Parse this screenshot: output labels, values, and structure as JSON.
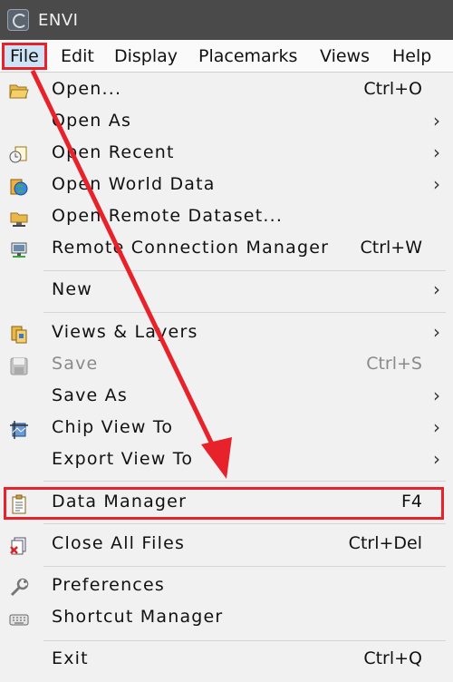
{
  "window": {
    "title": "ENVI"
  },
  "menubar": [
    {
      "label": "File",
      "active": true
    },
    {
      "label": "Edit"
    },
    {
      "label": "Display"
    },
    {
      "label": "Placemarks"
    },
    {
      "label": "Views"
    },
    {
      "label": "Help"
    }
  ],
  "file_menu": [
    {
      "label": "Open...",
      "shortcut": "Ctrl+O",
      "icon": "folder-open-icon"
    },
    {
      "label": "Open As",
      "submenu": true
    },
    {
      "label": "Open Recent",
      "submenu": true,
      "icon": "recent-files-icon"
    },
    {
      "label": "Open World Data",
      "submenu": true,
      "icon": "world-data-icon"
    },
    {
      "label": "Open Remote Dataset...",
      "icon": "remote-dataset-icon"
    },
    {
      "label": "Remote Connection Manager",
      "shortcut": "Ctrl+W",
      "icon": "remote-connection-icon"
    },
    {
      "label": "New",
      "submenu": true
    },
    {
      "label": "Views & Layers",
      "submenu": true,
      "icon": "views-layers-icon"
    },
    {
      "label": "Save",
      "shortcut": "Ctrl+S",
      "disabled": true,
      "icon": "save-icon"
    },
    {
      "label": "Save As",
      "submenu": true
    },
    {
      "label": "Chip View To",
      "submenu": true,
      "icon": "chip-view-icon"
    },
    {
      "label": "Export View To",
      "submenu": true
    },
    {
      "label": "Data Manager",
      "shortcut": "F4",
      "highlighted": true,
      "icon": "data-manager-icon"
    },
    {
      "label": "Close All Files",
      "shortcut": "Ctrl+Del",
      "icon": "close-all-files-icon"
    },
    {
      "label": "Preferences",
      "icon": "preferences-wrench-icon"
    },
    {
      "label": "Shortcut Manager",
      "icon": "keyboard-icon"
    },
    {
      "label": "Exit",
      "shortcut": "Ctrl+Q"
    }
  ],
  "colors": {
    "annotation_red": "#e8222a",
    "titlebar": "#4a4a4a",
    "menu_bg": "#f1f1f1"
  }
}
